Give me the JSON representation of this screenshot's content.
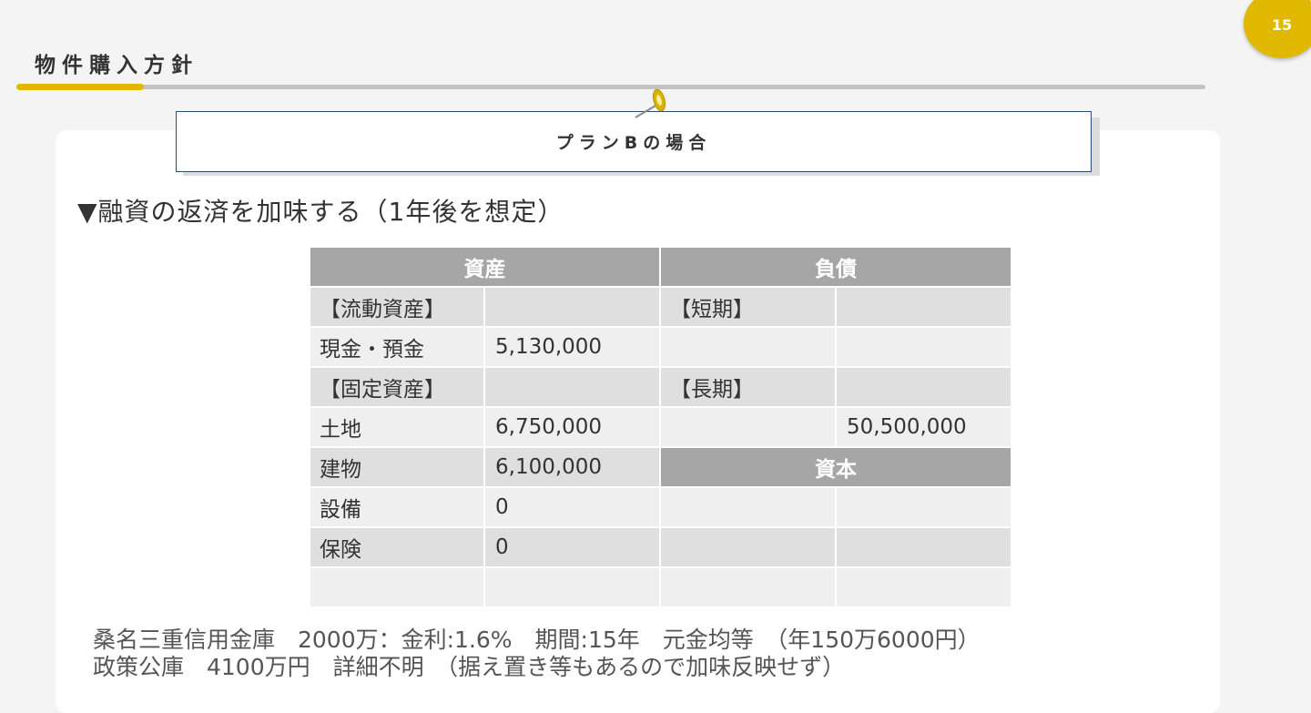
{
  "page": {
    "number": "15",
    "title": "物件購入方針"
  },
  "plan": {
    "title": "プランBの場合"
  },
  "section": {
    "heading": "▼融資の返済を加味する（1年後を想定）"
  },
  "balance_sheet": {
    "headers": {
      "assets": "資産",
      "liabilities": "負債",
      "capital": "資本"
    },
    "rows": [
      [
        "【流動資産】",
        "",
        "【短期】",
        ""
      ],
      [
        "現金・預金",
        "5,130,000",
        "",
        ""
      ],
      [
        "【固定資産】",
        "",
        "【長期】",
        ""
      ],
      [
        "土地",
        "6,750,000",
        "",
        "50,500,000"
      ],
      [
        "建物",
        "6,100,000",
        null,
        null
      ],
      [
        "設備",
        "0",
        "",
        ""
      ],
      [
        "保険",
        "0",
        "",
        ""
      ],
      [
        "",
        "",
        "",
        ""
      ]
    ]
  },
  "notes": [
    "桑名三重信用金庫　2000万：金利:1.6%　期間:15年　元金均等　（年150万6000円）",
    "政策公庫　4100万円　詳細不明　（据え置き等もあるので加味反映せず）"
  ],
  "colors": {
    "accent": "#e0b800",
    "header_cell": "#a6a6a6",
    "box_border": "#2f4a6e"
  }
}
